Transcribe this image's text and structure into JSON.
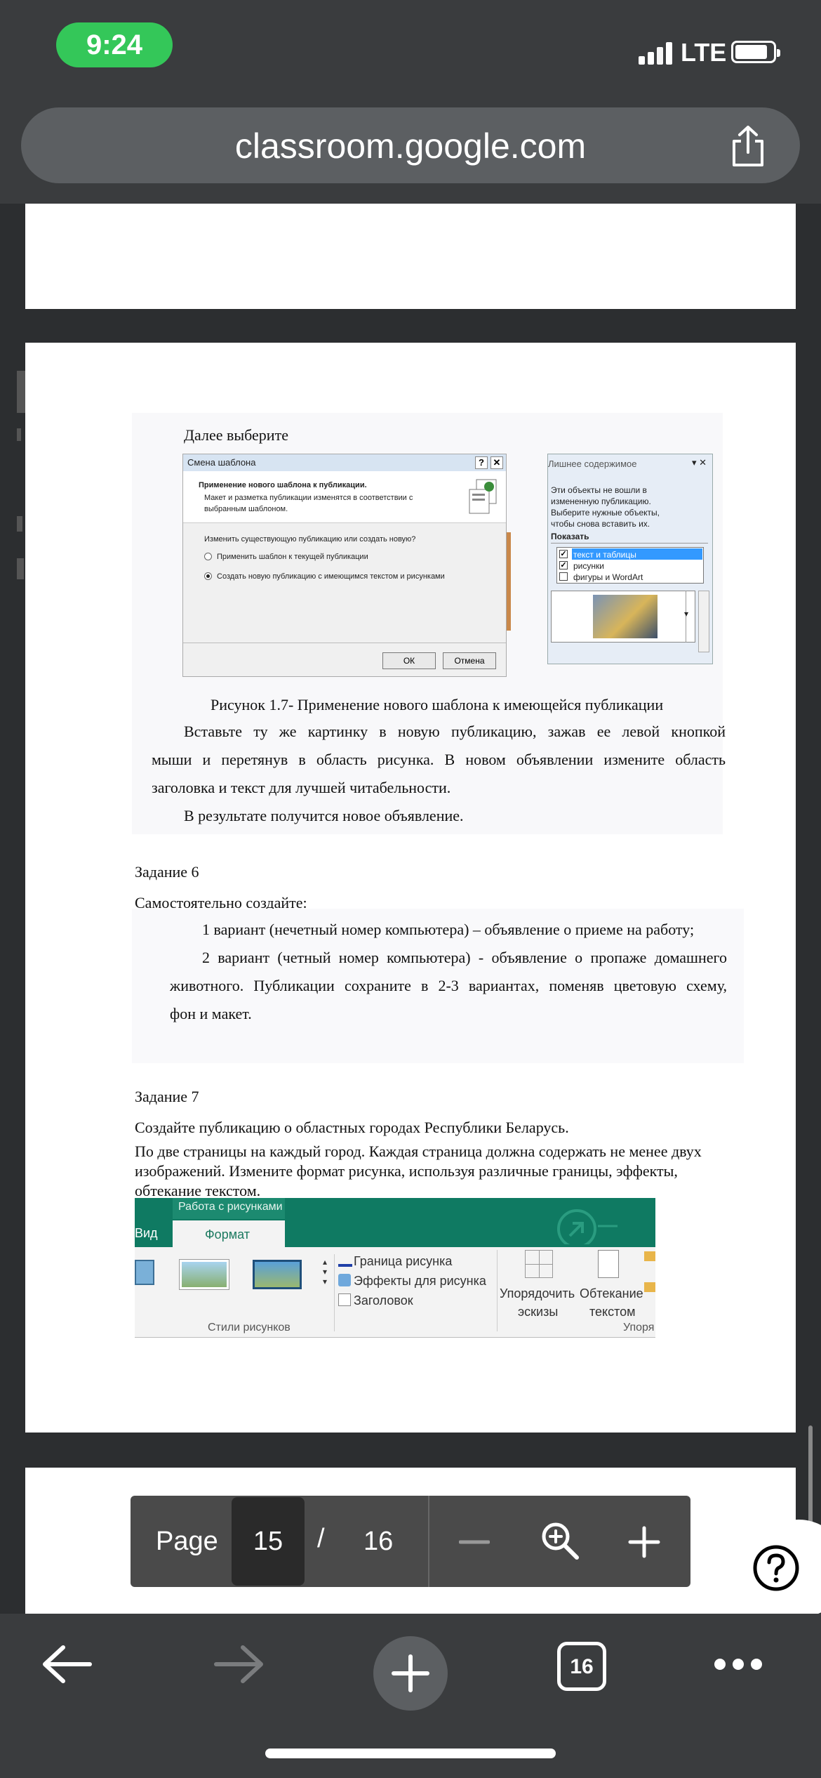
{
  "status": {
    "time": "9:24",
    "network": "LTE"
  },
  "browser": {
    "url": "classroom.google.com"
  },
  "document": {
    "intro": "Далее выберите",
    "dialog": {
      "title": "Смена шаблона",
      "heading": "Применение нового шаблона к публикации.",
      "desc1": "Макет и разметка публикации изменятся в соответствии с",
      "desc2": "выбранным шаблоном.",
      "question": "Изменить существующую публикацию или создать новую?",
      "option1": "Применить шаблон к текущей публикации",
      "option2": "Создать новую публикацию с имеющимся текстом и рисунками",
      "ok": "ОК",
      "cancel": "Отмена"
    },
    "pane": {
      "title": "Лишнее содержимое",
      "text1": "Эти объекты не вошли в",
      "text2": "измененную публикацию.",
      "text3": "Выберите нужные объекты,",
      "text4": "чтобы снова вставить их.",
      "show": "Показать",
      "opt1": "текст и таблицы",
      "opt2": "рисунки",
      "opt3": "фигуры и WordArt"
    },
    "caption": "Рисунок 1.7- Применение нового шаблона к имеющейся публикации",
    "para1_line1": "Вставьте ту же картинку в новую публикацию, зажав ее левой кнопкой",
    "para1_line2": "мыши и перетянув в область рисунка.  В новом объявлении измените область",
    "para1_line3": "заголовка и текст для лучшей читабельности.",
    "para2": "В результате получится новое объявление.",
    "task6_title": "Задание 6",
    "task6_sub": "Самостоятельно создайте:",
    "variant1": "1 вариант (нечетный номер компьютера) – объявление о приеме на работу;",
    "variant2_line1": "2 вариант (четный номер компьютера) - объявление о пропаже домашнего",
    "variant2_line2": "животного. Публикации сохраните в 2-3 вариантах, поменяв цветовую схему,",
    "variant2_line3": "фон и макет.",
    "task7_title": "Задание 7",
    "task7_line1": "Создайте публикацию о областных городах Республики Беларусь.",
    "task7_line2": "По две страницы на каждый город. Каждая страница должна содержать не менее двух",
    "task7_line3": "изображений. Измените формат рисунка, используя различные границы, эффекты,",
    "task7_line4": "обтекание текстом.",
    "ribbon": {
      "context": "Работа с рисунками",
      "tab_view": "Вид",
      "tab_format": "Формат",
      "border": "Граница рисунка",
      "effects": "Эффекты для рисунка",
      "caption": "Заголовок",
      "arrange1": "Упорядочить",
      "arrange2": "эскизы",
      "wrap1": "Обтекание",
      "wrap2": "текстом",
      "styles": "Стили рисунков",
      "order": "Упоря"
    }
  },
  "viewer": {
    "page_label": "Page",
    "current_page": "15",
    "separator": "/",
    "total_pages": "16"
  },
  "nav": {
    "tabs_count": "16"
  }
}
